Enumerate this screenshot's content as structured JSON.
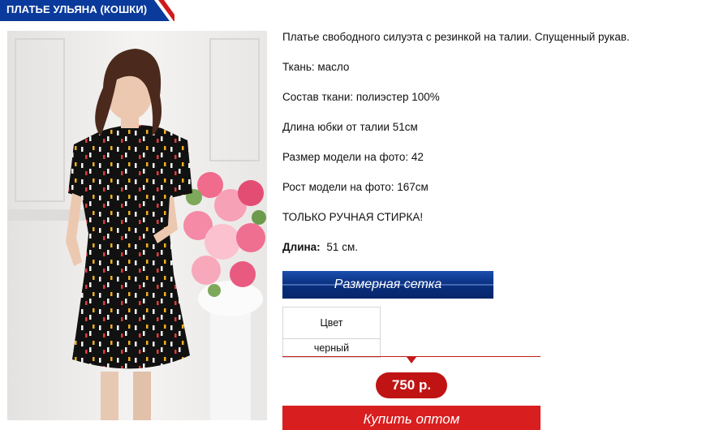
{
  "product": {
    "title": "ПЛАТЬЕ УЛЬЯНА (КОШКИ)"
  },
  "description": {
    "lines": [
      "Платье свободного силуэта с резинкой на талии. Спущенный рукав.",
      "Ткань: масло",
      "Состав ткани: полиэстер 100%",
      "Длина юбки от талии 51см",
      "Размер модели на фото: 42",
      "Рост модели на фото: 167см",
      "ТОЛЬКО РУЧНАЯ СТИРКА!"
    ],
    "length_label": "Длина:",
    "length_value": "51 см."
  },
  "size_chart_button": "Размерная сетка",
  "color_table": {
    "header": "Цвет",
    "value": "черный"
  },
  "price": "750 р.",
  "buy_wholesale_button": "Купить оптом",
  "colors": {
    "title_bg": "#0a3a9b",
    "title_corner": "#d01b1b",
    "button_blue": "#0a2f7e",
    "accent_red": "#c01414"
  }
}
